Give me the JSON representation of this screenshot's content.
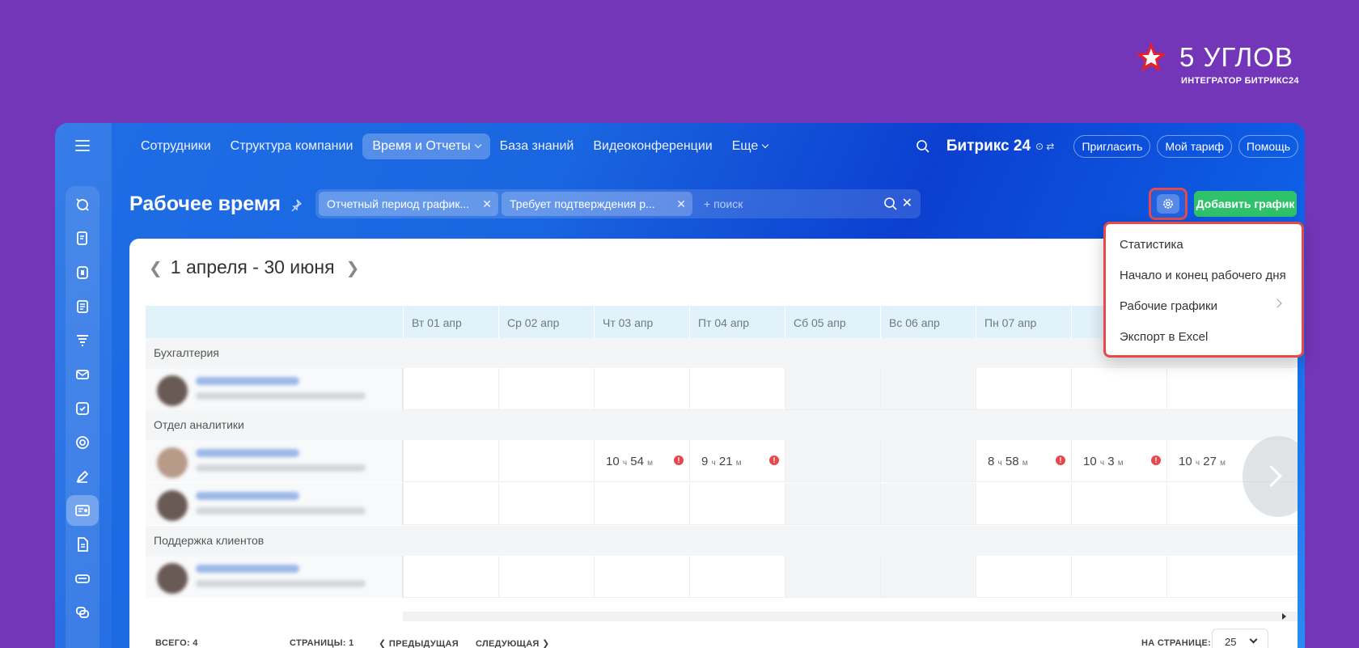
{
  "brand": {
    "name": "5 УГЛОВ",
    "subtitle": "ИНТЕГРАТОР БИТРИКС24",
    "color": "#e5202e"
  },
  "topmenu": {
    "items": [
      {
        "label": "Сотрудники",
        "active": false
      },
      {
        "label": "Структура компании",
        "active": false
      },
      {
        "label": "Время и Отчеты",
        "active": true
      },
      {
        "label": "База знаний",
        "active": false
      },
      {
        "label": "Видеоконференции",
        "active": false
      },
      {
        "label": "Еще",
        "active": false
      }
    ]
  },
  "header": {
    "logo": "Битрикс 24",
    "invite": "Пригласить",
    "tariff": "Мой тариф",
    "help": "Помощь"
  },
  "page": {
    "title": "Рабочее время",
    "filters": [
      "Отчетный период график...",
      "Требует подтверждения р..."
    ],
    "search_placeholder": "+ поиск",
    "add_schedule": "Добавить график"
  },
  "period": "1 апреля - 30 июня",
  "days": [
    "Вт 01 апр",
    "Ср 02 апр",
    "Чт 03 апр",
    "Пт 04 апр",
    "Сб 05 апр",
    "Вс 06 апр",
    "Пн 07 апр"
  ],
  "groups": [
    {
      "name": "Бухгалтерия"
    },
    {
      "name": "Отдел аналитики"
    },
    {
      "name": "Поддержка клиентов"
    }
  ],
  "worktime": [
    {
      "h": "10",
      "hu": "ч",
      "m": "54",
      "mu": "м"
    },
    {
      "h": "9",
      "hu": "ч",
      "m": "21",
      "mu": "м"
    },
    {
      "h": "8",
      "hu": "ч",
      "m": "58",
      "mu": "м"
    },
    {
      "h": "10",
      "hu": "ч",
      "m": "3",
      "mu": "м"
    },
    {
      "h": "10",
      "hu": "ч",
      "m": "27",
      "mu": "м"
    }
  ],
  "warn_symbol": "!",
  "footer": {
    "total": "ВСЕГО: 4",
    "pages": "СТРАНИЦЫ:  1",
    "prev": "❮ ПРЕДЫДУЩАЯ",
    "next": "СЛЕДУЮЩАЯ ❯",
    "per_page_label": "НА СТРАНИЦЕ:",
    "per_page_value": "25"
  },
  "dropdown": {
    "items": [
      "Статистика",
      "Начало и конец рабочего дня",
      "Рабочие графики",
      "Экспорт в Excel"
    ]
  },
  "colors": {
    "background": "#7336b8",
    "accent": "#2fc26b",
    "highlight": "#e5484d"
  }
}
